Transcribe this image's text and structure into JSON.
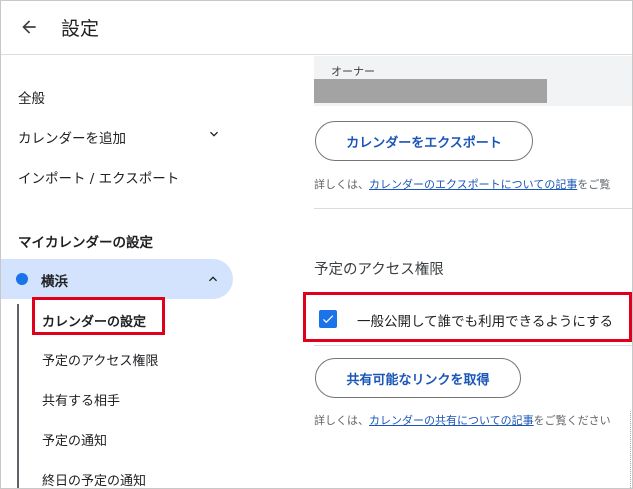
{
  "header": {
    "title": "設定",
    "back_icon": "arrow-left-icon"
  },
  "sidebar": {
    "items": [
      {
        "label": "全般"
      },
      {
        "label": "カレンダーを追加",
        "icon": "chevron-down-icon"
      },
      {
        "label": "インポート / エクスポート"
      }
    ],
    "my_calendars_heading": "マイカレンダーの設定",
    "calendar": {
      "name": "横浜",
      "dot_color": "#1a73e8",
      "icon": "chevron-up-icon"
    },
    "sub_items": [
      {
        "label": "カレンダーの設定",
        "active": true
      },
      {
        "label": "予定のアクセス権限"
      },
      {
        "label": "共有する相手"
      },
      {
        "label": "予定の通知"
      },
      {
        "label": "終日の予定の通知"
      }
    ]
  },
  "main": {
    "owner_label": "オーナー",
    "export_button": "カレンダーをエクスポート",
    "export_info": {
      "prefix": "詳しくは、",
      "link": "カレンダーのエクスポートについての記事",
      "suffix": "をご覧"
    },
    "access_heading": "予定のアクセス権限",
    "public_checkbox": {
      "label": "一般公開して誰でも利用できるようにする",
      "checked": true
    },
    "share_link_button": "共有可能なリンクを取得",
    "share_info": {
      "prefix": "詳しくは、",
      "link": "カレンダーの共有についての記事",
      "suffix": "をご覧ください"
    }
  },
  "colors": {
    "accent": "#1a73e8",
    "highlight": "#e0001b",
    "selected_bg": "#d3e3fd"
  }
}
